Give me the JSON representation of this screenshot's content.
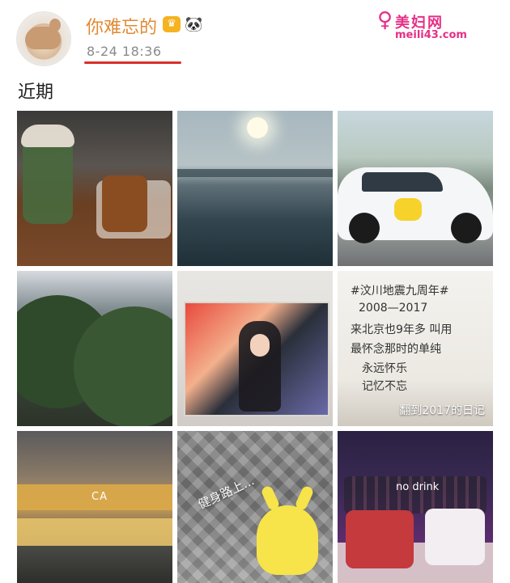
{
  "header": {
    "user_name": "你难忘的",
    "timestamp": "8-24 18:36"
  },
  "watermark": {
    "site_name": "美妇网",
    "url": "meili43.com"
  },
  "section": {
    "title": "近期"
  },
  "photos": [
    {
      "caption": ""
    },
    {
      "caption": ""
    },
    {
      "caption": ""
    },
    {
      "caption": ""
    },
    {
      "caption": ""
    },
    {
      "caption": "翻到2017的日记",
      "note_lines": [
        "#汶川地震九周年#",
        "2008—2017",
        "来北京也9年多 叫用",
        "最怀念那时的单纯",
        "永远怀乐",
        "记忆不忘"
      ]
    },
    {
      "caption": "",
      "signage": "CA"
    },
    {
      "caption": "健身路上..."
    },
    {
      "caption": "no drink"
    }
  ]
}
